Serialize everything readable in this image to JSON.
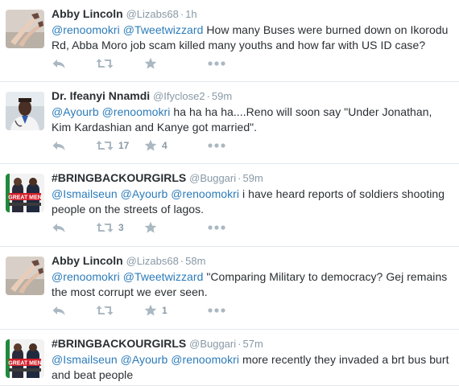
{
  "tweets": [
    {
      "fullname": "Abby Lincoln",
      "username": "@Lizabs68",
      "time": "1h",
      "segments": [
        {
          "t": "@renoomokri",
          "m": true
        },
        {
          "t": " ",
          "m": false
        },
        {
          "t": "@Tweetwizzard",
          "m": true
        },
        {
          "t": " How many Buses were burned down on Ikorodu Rd, Abba Moro job scam killed many youths and how far with US ID case?",
          "m": false
        }
      ],
      "retweet_count": "",
      "favorite_count": "",
      "avatar": "legs-photo-avatar"
    },
    {
      "fullname": "Dr. Ifeanyi Nnamdi",
      "username": "@Ifyclose2",
      "time": "59m",
      "segments": [
        {
          "t": "@Ayourb",
          "m": true
        },
        {
          "t": " ",
          "m": false
        },
        {
          "t": "@renoomokri",
          "m": true
        },
        {
          "t": " ha ha ha ha....Reno will soon say \"Under Jonathan, Kim Kardashian and Kanye got married\".",
          "m": false
        }
      ],
      "retweet_count": "17",
      "favorite_count": "4",
      "avatar": "doctor-photo-avatar"
    },
    {
      "fullname": "#BRINGBACKOURGIRLS",
      "username": "@Buggari",
      "time": "59m",
      "segments": [
        {
          "t": "@Ismailseun",
          "m": true
        },
        {
          "t": " ",
          "m": false
        },
        {
          "t": "@Ayourb",
          "m": true
        },
        {
          "t": " ",
          "m": false
        },
        {
          "t": "@renoomokri",
          "m": true
        },
        {
          "t": " i have heard reports of soldiers shooting people on the streets of lagos.",
          "m": false
        }
      ],
      "retweet_count": "3",
      "favorite_count": "",
      "avatar": "great-men-avatar"
    },
    {
      "fullname": "Abby Lincoln",
      "username": "@Lizabs68",
      "time": "58m",
      "segments": [
        {
          "t": "@renoomokri",
          "m": true
        },
        {
          "t": " ",
          "m": false
        },
        {
          "t": "@Tweetwizzard",
          "m": true
        },
        {
          "t": " \"Comparing Military to democracy? Gej remains the most corrupt we ever seen.",
          "m": false
        }
      ],
      "retweet_count": "",
      "favorite_count": "1",
      "avatar": "legs-photo-avatar"
    },
    {
      "fullname": "#BRINGBACKOURGIRLS",
      "username": "@Buggari",
      "time": "57m",
      "segments": [
        {
          "t": "@Ismailseun",
          "m": true
        },
        {
          "t": " ",
          "m": false
        },
        {
          "t": "@Ayourb",
          "m": true
        },
        {
          "t": " ",
          "m": false
        },
        {
          "t": "@renoomokri",
          "m": true
        },
        {
          "t": " more recently they invaded a brt bus burt and beat people",
          "m": false
        }
      ],
      "retweet_count": "",
      "favorite_count": "",
      "avatar": "great-men-avatar"
    }
  ],
  "avatar_label": "GREAT MEN",
  "dot": "·",
  "colors": {
    "mention": "#2b7bb9",
    "name": "#292f33",
    "meta": "#8899a6",
    "icon": "#aab8c2",
    "divider": "#e1e8ed"
  }
}
